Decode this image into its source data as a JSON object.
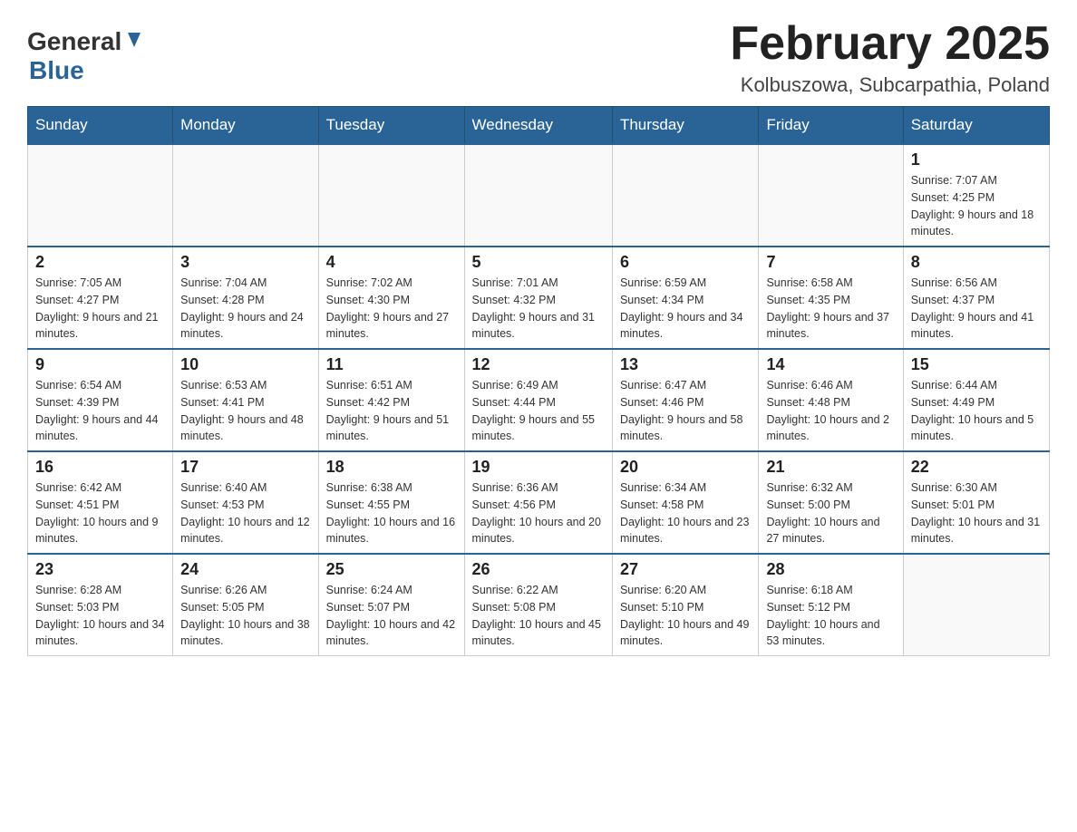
{
  "header": {
    "logo": {
      "general": "General",
      "blue": "Blue",
      "arrow_color": "#2a6496"
    },
    "title": "February 2025",
    "subtitle": "Kolbuszowa, Subcarpathia, Poland"
  },
  "weekdays": [
    "Sunday",
    "Monday",
    "Tuesday",
    "Wednesday",
    "Thursday",
    "Friday",
    "Saturday"
  ],
  "weeks": [
    [
      {
        "day": "",
        "info": ""
      },
      {
        "day": "",
        "info": ""
      },
      {
        "day": "",
        "info": ""
      },
      {
        "day": "",
        "info": ""
      },
      {
        "day": "",
        "info": ""
      },
      {
        "day": "",
        "info": ""
      },
      {
        "day": "1",
        "info": "Sunrise: 7:07 AM\nSunset: 4:25 PM\nDaylight: 9 hours and 18 minutes."
      }
    ],
    [
      {
        "day": "2",
        "info": "Sunrise: 7:05 AM\nSunset: 4:27 PM\nDaylight: 9 hours and 21 minutes."
      },
      {
        "day": "3",
        "info": "Sunrise: 7:04 AM\nSunset: 4:28 PM\nDaylight: 9 hours and 24 minutes."
      },
      {
        "day": "4",
        "info": "Sunrise: 7:02 AM\nSunset: 4:30 PM\nDaylight: 9 hours and 27 minutes."
      },
      {
        "day": "5",
        "info": "Sunrise: 7:01 AM\nSunset: 4:32 PM\nDaylight: 9 hours and 31 minutes."
      },
      {
        "day": "6",
        "info": "Sunrise: 6:59 AM\nSunset: 4:34 PM\nDaylight: 9 hours and 34 minutes."
      },
      {
        "day": "7",
        "info": "Sunrise: 6:58 AM\nSunset: 4:35 PM\nDaylight: 9 hours and 37 minutes."
      },
      {
        "day": "8",
        "info": "Sunrise: 6:56 AM\nSunset: 4:37 PM\nDaylight: 9 hours and 41 minutes."
      }
    ],
    [
      {
        "day": "9",
        "info": "Sunrise: 6:54 AM\nSunset: 4:39 PM\nDaylight: 9 hours and 44 minutes."
      },
      {
        "day": "10",
        "info": "Sunrise: 6:53 AM\nSunset: 4:41 PM\nDaylight: 9 hours and 48 minutes."
      },
      {
        "day": "11",
        "info": "Sunrise: 6:51 AM\nSunset: 4:42 PM\nDaylight: 9 hours and 51 minutes."
      },
      {
        "day": "12",
        "info": "Sunrise: 6:49 AM\nSunset: 4:44 PM\nDaylight: 9 hours and 55 minutes."
      },
      {
        "day": "13",
        "info": "Sunrise: 6:47 AM\nSunset: 4:46 PM\nDaylight: 9 hours and 58 minutes."
      },
      {
        "day": "14",
        "info": "Sunrise: 6:46 AM\nSunset: 4:48 PM\nDaylight: 10 hours and 2 minutes."
      },
      {
        "day": "15",
        "info": "Sunrise: 6:44 AM\nSunset: 4:49 PM\nDaylight: 10 hours and 5 minutes."
      }
    ],
    [
      {
        "day": "16",
        "info": "Sunrise: 6:42 AM\nSunset: 4:51 PM\nDaylight: 10 hours and 9 minutes."
      },
      {
        "day": "17",
        "info": "Sunrise: 6:40 AM\nSunset: 4:53 PM\nDaylight: 10 hours and 12 minutes."
      },
      {
        "day": "18",
        "info": "Sunrise: 6:38 AM\nSunset: 4:55 PM\nDaylight: 10 hours and 16 minutes."
      },
      {
        "day": "19",
        "info": "Sunrise: 6:36 AM\nSunset: 4:56 PM\nDaylight: 10 hours and 20 minutes."
      },
      {
        "day": "20",
        "info": "Sunrise: 6:34 AM\nSunset: 4:58 PM\nDaylight: 10 hours and 23 minutes."
      },
      {
        "day": "21",
        "info": "Sunrise: 6:32 AM\nSunset: 5:00 PM\nDaylight: 10 hours and 27 minutes."
      },
      {
        "day": "22",
        "info": "Sunrise: 6:30 AM\nSunset: 5:01 PM\nDaylight: 10 hours and 31 minutes."
      }
    ],
    [
      {
        "day": "23",
        "info": "Sunrise: 6:28 AM\nSunset: 5:03 PM\nDaylight: 10 hours and 34 minutes."
      },
      {
        "day": "24",
        "info": "Sunrise: 6:26 AM\nSunset: 5:05 PM\nDaylight: 10 hours and 38 minutes."
      },
      {
        "day": "25",
        "info": "Sunrise: 6:24 AM\nSunset: 5:07 PM\nDaylight: 10 hours and 42 minutes."
      },
      {
        "day": "26",
        "info": "Sunrise: 6:22 AM\nSunset: 5:08 PM\nDaylight: 10 hours and 45 minutes."
      },
      {
        "day": "27",
        "info": "Sunrise: 6:20 AM\nSunset: 5:10 PM\nDaylight: 10 hours and 49 minutes."
      },
      {
        "day": "28",
        "info": "Sunrise: 6:18 AM\nSunset: 5:12 PM\nDaylight: 10 hours and 53 minutes."
      },
      {
        "day": "",
        "info": ""
      }
    ]
  ]
}
